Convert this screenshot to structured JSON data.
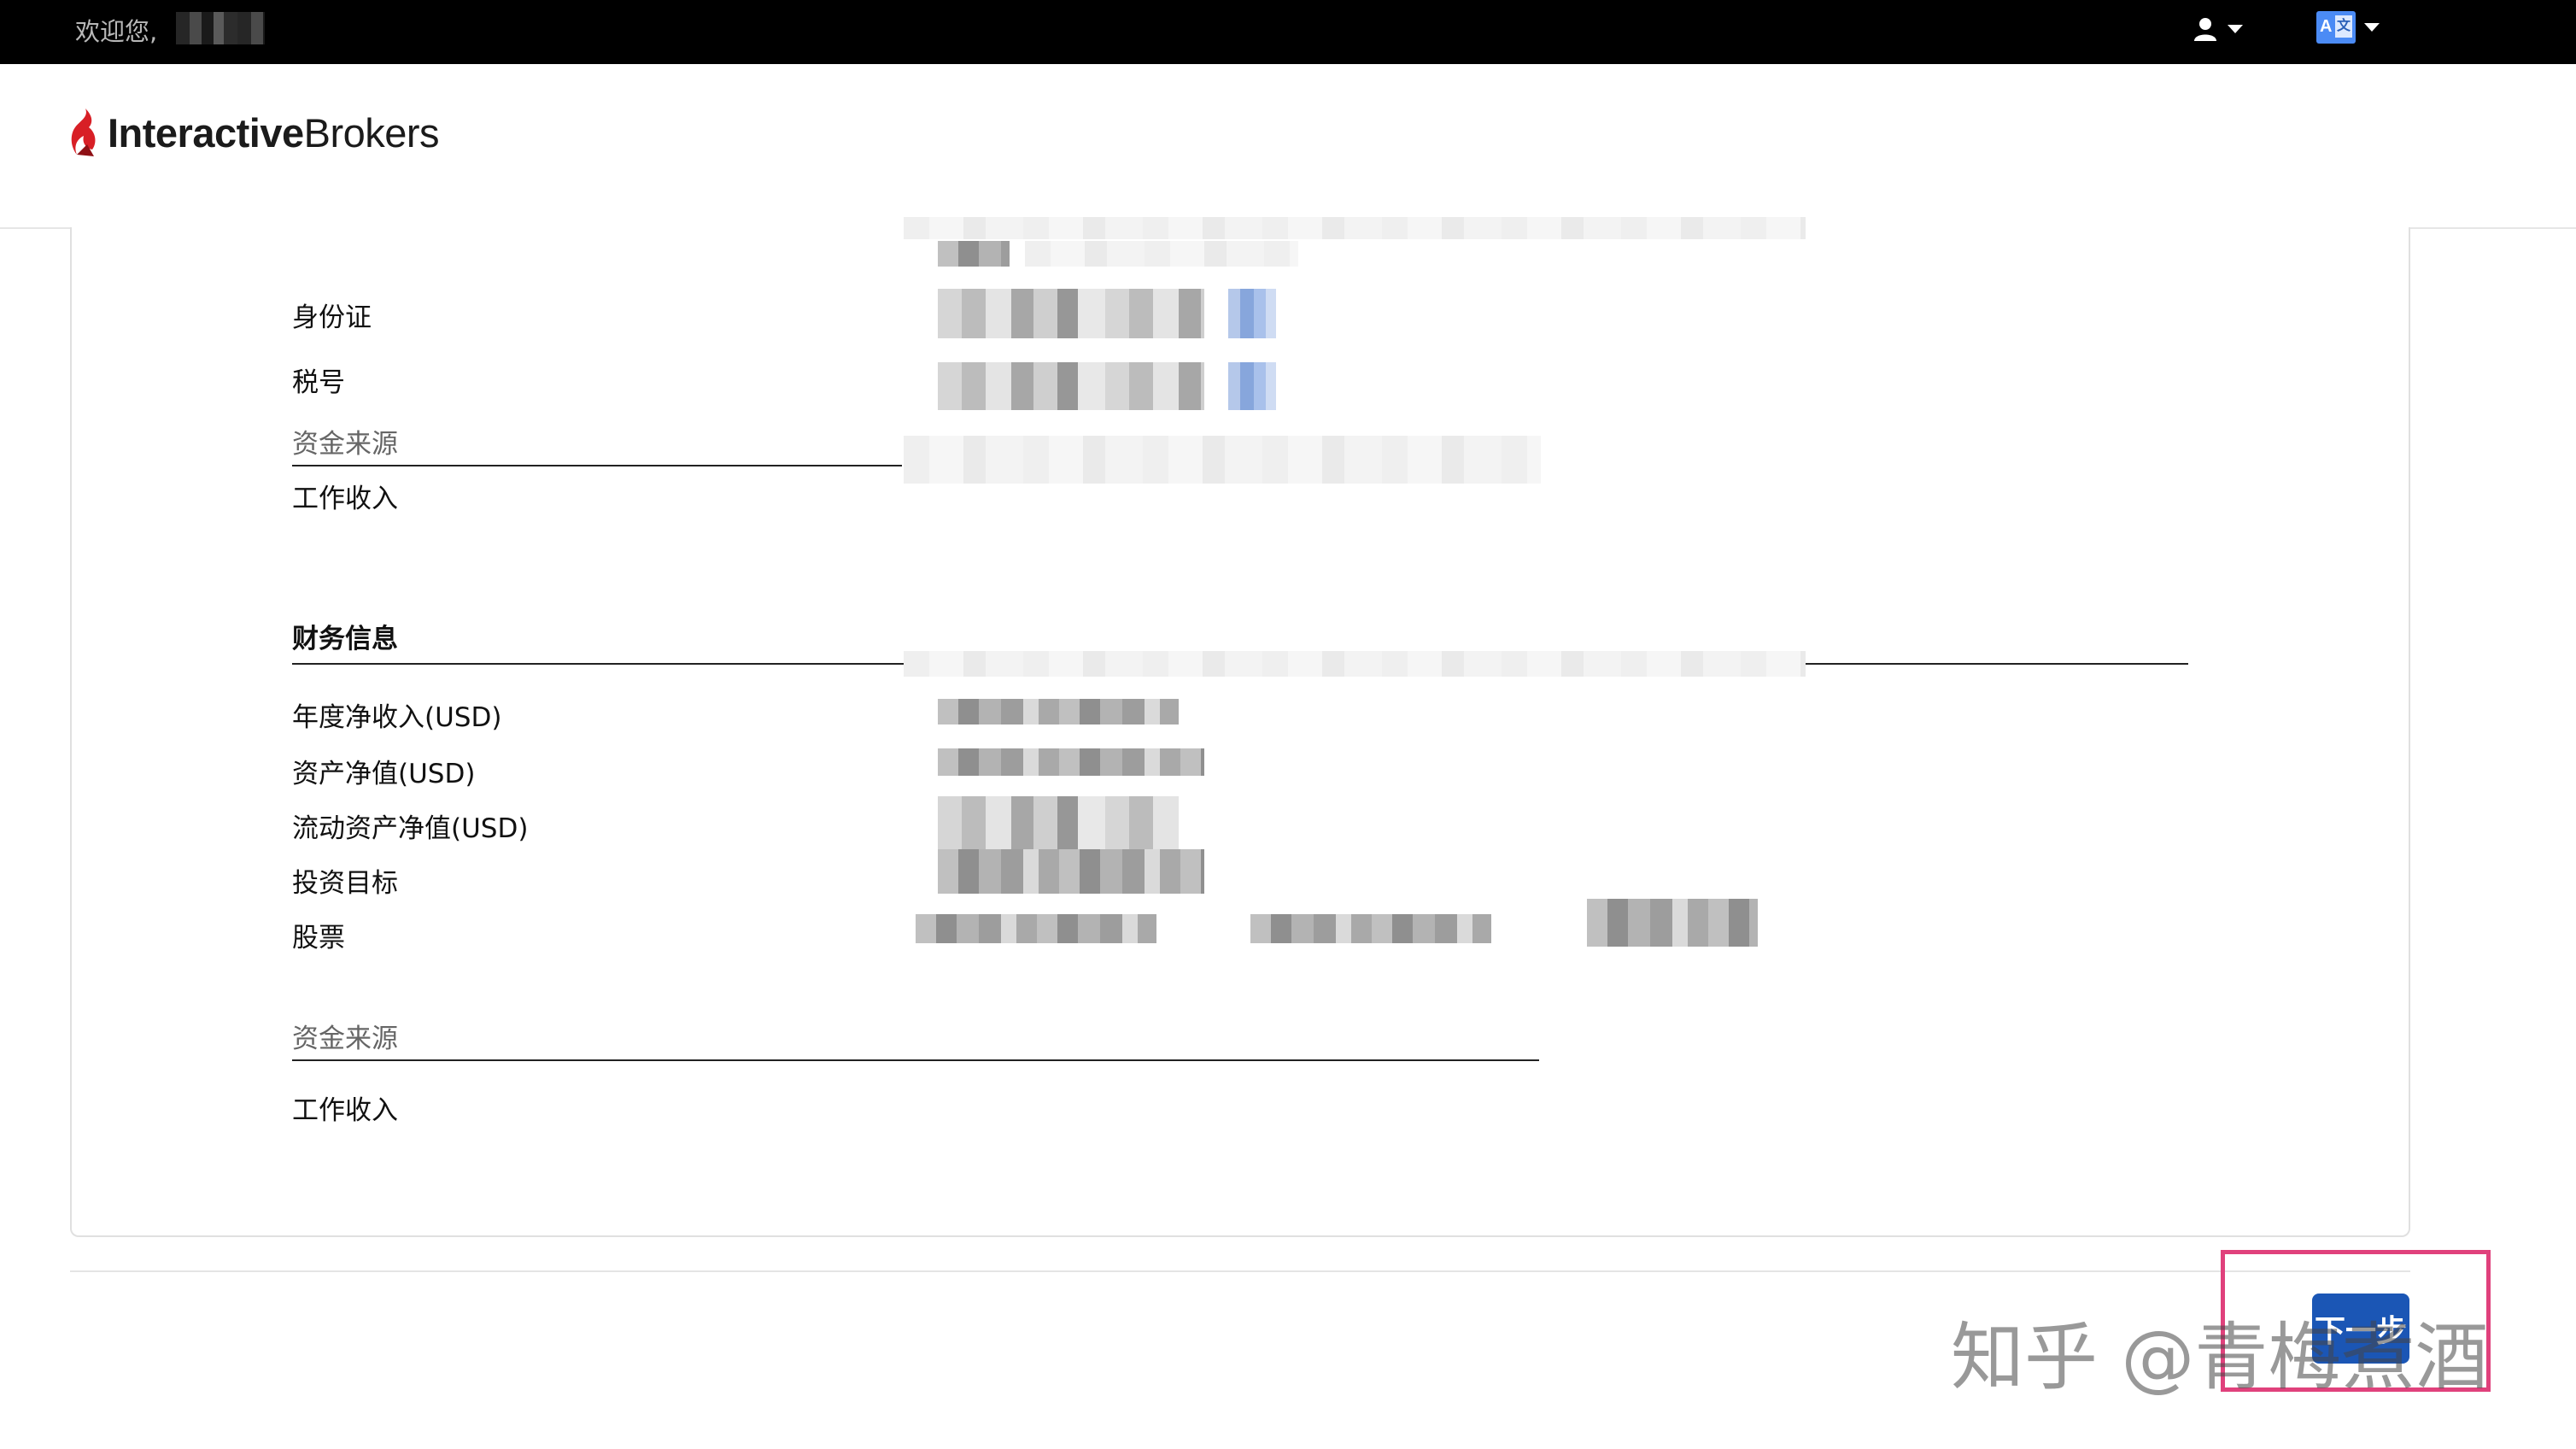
{
  "topbar": {
    "welcome_text": "欢迎您,",
    "user_icon": "user-icon",
    "language_icon": "translate-icon",
    "language_box_a": "A",
    "language_box_b": "文"
  },
  "header": {
    "logo_bold": "Interactive",
    "logo_regular": "Brokers",
    "logo_icon": "ib-flame-logo-icon",
    "brand_color": "#d81f26"
  },
  "personal": {
    "id_card_label": "身份证",
    "tax_id_label": "税号",
    "fund_source_label": "资金来源",
    "fund_source_value": "工作收入"
  },
  "financial": {
    "title": "财务信息",
    "annual_net_income_label": "年度净收入(USD)",
    "net_worth_label": "资产净值(USD)",
    "liquid_net_worth_label": "流动资产净值(USD)",
    "investment_objective_label": "投资目标",
    "stocks_label": "股票",
    "fund_source_label": "资金来源",
    "fund_source_value": "工作收入"
  },
  "footer": {
    "next_button_label": "下一步",
    "button_color": "#1b56b5",
    "highlight_color": "#e0417c"
  },
  "watermark": {
    "text": "知乎 @青梅煮酒"
  }
}
